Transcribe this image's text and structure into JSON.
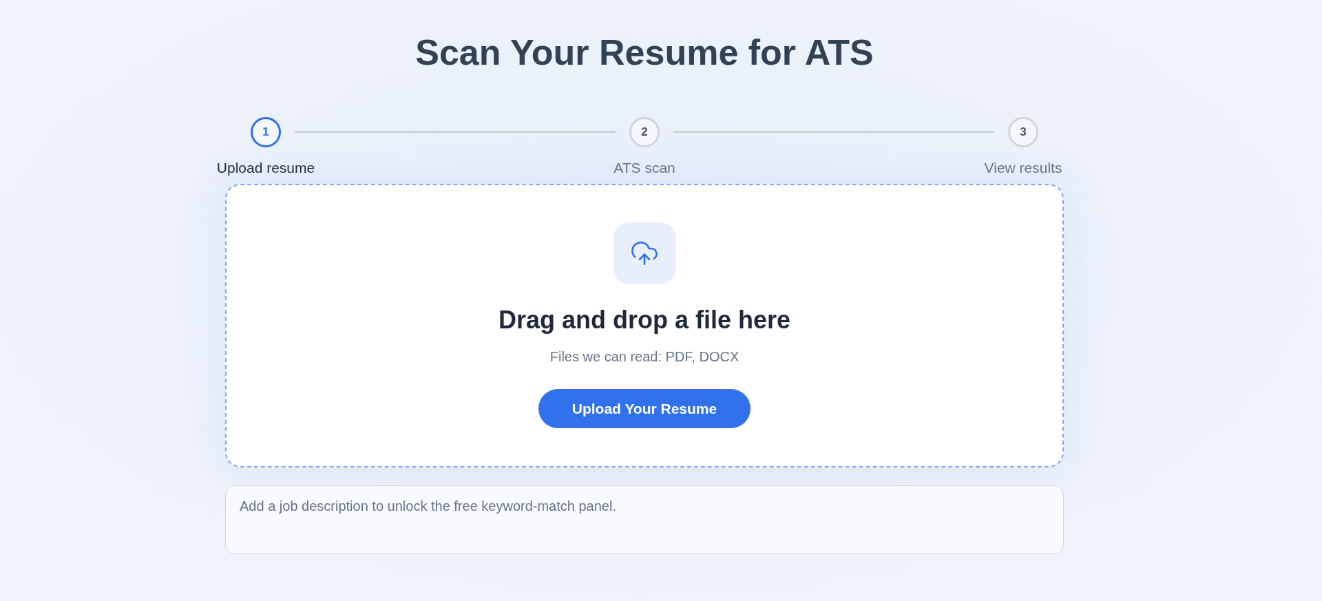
{
  "title": "Scan Your Resume for ATS",
  "steps": [
    {
      "number": "1",
      "label": "Upload resume",
      "current": true
    },
    {
      "number": "2",
      "label": "ATS scan",
      "current": false
    },
    {
      "number": "3",
      "label": "View results",
      "current": false
    }
  ],
  "dropzone": {
    "heading": "Drag and drop a file here",
    "note": "Files we can read: PDF, DOCX",
    "button": "Upload Your Resume"
  },
  "job_description": {
    "placeholder": "Add a job description to unlock the free keyword-match panel."
  }
}
